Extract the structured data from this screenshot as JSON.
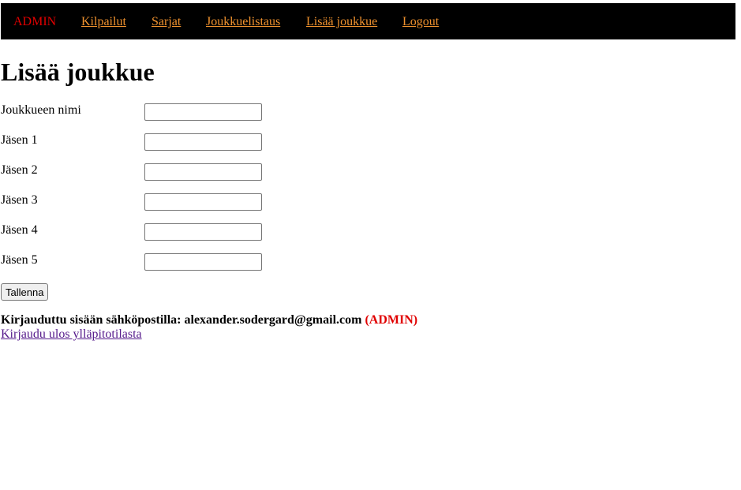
{
  "nav": {
    "brand": "ADMIN",
    "links": [
      "Kilpailut",
      "Sarjat",
      "Joukkuelistaus",
      "Lisää joukkue",
      "Logout"
    ]
  },
  "page": {
    "title": "Lisää joukkue"
  },
  "form": {
    "fields": [
      {
        "label": "Joukkueen nimi",
        "value": ""
      },
      {
        "label": "Jäsen 1",
        "value": ""
      },
      {
        "label": "Jäsen 2",
        "value": ""
      },
      {
        "label": "Jäsen 3",
        "value": ""
      },
      {
        "label": "Jäsen 4",
        "value": ""
      },
      {
        "label": "Jäsen 5",
        "value": ""
      }
    ],
    "submit_label": "Tallenna"
  },
  "footer": {
    "login_text": "Kirjauduttu sisään sähköpostilla: alexander.sodergard@gmail.com",
    "role_text": "(ADMIN)",
    "logout_admin_link": "Kirjaudu ulos ylläpitotilasta"
  },
  "colors": {
    "nav_background": "#000000",
    "nav_link": "#f0922e",
    "brand": "#e00000",
    "visited_link": "#551a8b"
  }
}
